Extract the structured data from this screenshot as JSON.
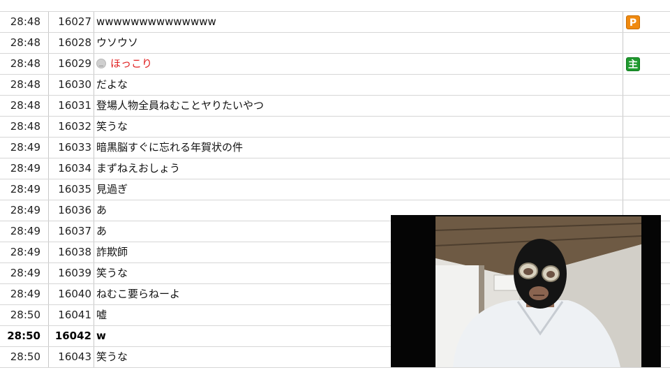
{
  "comments": [
    {
      "time": "28:48",
      "number": "16027",
      "text": "wwwwwwwwwwwwww",
      "badge": "P",
      "badge_type": "premium"
    },
    {
      "time": "28:48",
      "number": "16028",
      "text": "ウソウソ"
    },
    {
      "time": "28:48",
      "number": "16029",
      "text": "ほっこり",
      "color": "red",
      "icon": "grey-face-icon",
      "badge": "主",
      "badge_type": "owner"
    },
    {
      "time": "28:48",
      "number": "16030",
      "text": "だよな"
    },
    {
      "time": "28:48",
      "number": "16031",
      "text": "登場人物全員ねむことヤりたいやつ"
    },
    {
      "time": "28:48",
      "number": "16032",
      "text": "笑うな"
    },
    {
      "time": "28:49",
      "number": "16033",
      "text": "暗黒脳すぐに忘れる年賀状の件"
    },
    {
      "time": "28:49",
      "number": "16034",
      "text": "まずねえおしょう"
    },
    {
      "time": "28:49",
      "number": "16035",
      "text": "見過ぎ"
    },
    {
      "time": "28:49",
      "number": "16036",
      "text": "あ"
    },
    {
      "time": "28:49",
      "number": "16037",
      "text": "あ"
    },
    {
      "time": "28:49",
      "number": "16038",
      "text": "詐欺師"
    },
    {
      "time": "28:49",
      "number": "16039",
      "text": "笑うな"
    },
    {
      "time": "28:49",
      "number": "16040",
      "text": "ねむこ要らねーよ"
    },
    {
      "time": "28:50",
      "number": "16041",
      "text": "嘘"
    },
    {
      "time": "28:50",
      "number": "16042",
      "text": "w",
      "bold": true
    },
    {
      "time": "28:50",
      "number": "16043",
      "text": "笑うな"
    }
  ],
  "colors": {
    "grid_line": "#d6d6d6",
    "red_comment": "#e02020",
    "premium_badge": "#f08a10",
    "owner_badge": "#1f9a2e"
  }
}
